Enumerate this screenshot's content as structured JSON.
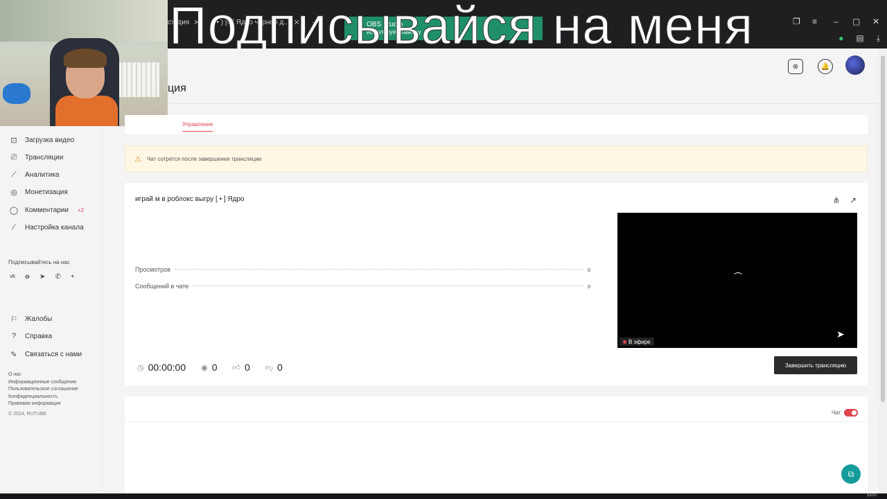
{
  "browser": {
    "tabs": [
      {
        "label": "студия"
      },
      {
        "label": "( • ) [©] Ядро черной д..."
      }
    ],
    "new_tab": "+",
    "obs_toast": {
      "title": "OBS Studio",
      "subtitle": "использует камеру"
    }
  },
  "overlay_text": "Подписывайся на меня",
  "header": {
    "title": "ция"
  },
  "sidebar": {
    "items": [
      {
        "label": "Загрузка видео",
        "icon": "upload-icon"
      },
      {
        "label": "Трансляции",
        "icon": "broadcast-icon"
      },
      {
        "label": "Аналитика",
        "icon": "chart-icon"
      },
      {
        "label": "Монетизация",
        "icon": "coin-icon"
      },
      {
        "label": "Комментарии",
        "icon": "comment-icon",
        "badge": "+2"
      },
      {
        "label": "Настройка канала",
        "icon": "wand-icon"
      }
    ],
    "subscribe_title": "Подписывайтесь на нас",
    "socials": [
      "vk",
      "ok",
      "telegram",
      "viber",
      "+"
    ],
    "bottom_items": [
      {
        "label": "Жалобы",
        "icon": "flag-icon"
      },
      {
        "label": "Справка",
        "icon": "help-icon"
      },
      {
        "label": "Связаться с нами",
        "icon": "pencil-icon"
      }
    ],
    "footer_links": [
      "О нас",
      "Информационные сообщения",
      "Пользовательское соглашение",
      "Конфиденциальность",
      "Правовая информация"
    ],
    "copyright": "© 2024, RUTUBE"
  },
  "tabs": {
    "manage": "Управление"
  },
  "warning": {
    "text": "Чат сотрется после завершения трансляции"
  },
  "stream": {
    "title": "играй м в роблокс выгру [ • ] Ядро",
    "stats": [
      {
        "label": "Просмотров",
        "value": "0"
      },
      {
        "label": "Сообщений в чате",
        "value": "0"
      }
    ],
    "live_label": "В эфире",
    "metrics": {
      "time": "00:00:00",
      "viewers": "0",
      "likes": "0",
      "dislikes": "0"
    },
    "end_button": "Завершить трансляцию"
  },
  "chat": {
    "label": "Чат",
    "enabled": true
  },
  "colors": {
    "accent": "#e0444f",
    "fab": "#169b9b",
    "toast": "#1f8f6a"
  },
  "taskbar": {
    "clock": "15:07"
  }
}
